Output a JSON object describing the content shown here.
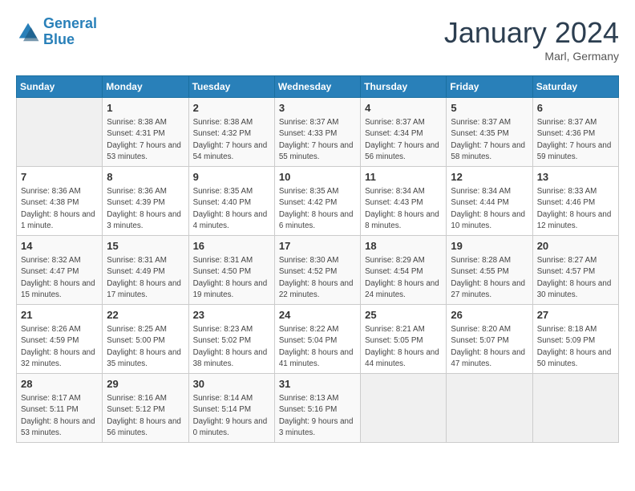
{
  "header": {
    "logo_line1": "General",
    "logo_line2": "Blue",
    "month": "January 2024",
    "location": "Marl, Germany"
  },
  "days_of_week": [
    "Sunday",
    "Monday",
    "Tuesday",
    "Wednesday",
    "Thursday",
    "Friday",
    "Saturday"
  ],
  "weeks": [
    [
      {
        "day": "",
        "sunrise": "",
        "sunset": "",
        "daylight": ""
      },
      {
        "day": "1",
        "sunrise": "Sunrise: 8:38 AM",
        "sunset": "Sunset: 4:31 PM",
        "daylight": "Daylight: 7 hours and 53 minutes."
      },
      {
        "day": "2",
        "sunrise": "Sunrise: 8:38 AM",
        "sunset": "Sunset: 4:32 PM",
        "daylight": "Daylight: 7 hours and 54 minutes."
      },
      {
        "day": "3",
        "sunrise": "Sunrise: 8:37 AM",
        "sunset": "Sunset: 4:33 PM",
        "daylight": "Daylight: 7 hours and 55 minutes."
      },
      {
        "day": "4",
        "sunrise": "Sunrise: 8:37 AM",
        "sunset": "Sunset: 4:34 PM",
        "daylight": "Daylight: 7 hours and 56 minutes."
      },
      {
        "day": "5",
        "sunrise": "Sunrise: 8:37 AM",
        "sunset": "Sunset: 4:35 PM",
        "daylight": "Daylight: 7 hours and 58 minutes."
      },
      {
        "day": "6",
        "sunrise": "Sunrise: 8:37 AM",
        "sunset": "Sunset: 4:36 PM",
        "daylight": "Daylight: 7 hours and 59 minutes."
      }
    ],
    [
      {
        "day": "7",
        "sunrise": "Sunrise: 8:36 AM",
        "sunset": "Sunset: 4:38 PM",
        "daylight": "Daylight: 8 hours and 1 minute."
      },
      {
        "day": "8",
        "sunrise": "Sunrise: 8:36 AM",
        "sunset": "Sunset: 4:39 PM",
        "daylight": "Daylight: 8 hours and 3 minutes."
      },
      {
        "day": "9",
        "sunrise": "Sunrise: 8:35 AM",
        "sunset": "Sunset: 4:40 PM",
        "daylight": "Daylight: 8 hours and 4 minutes."
      },
      {
        "day": "10",
        "sunrise": "Sunrise: 8:35 AM",
        "sunset": "Sunset: 4:42 PM",
        "daylight": "Daylight: 8 hours and 6 minutes."
      },
      {
        "day": "11",
        "sunrise": "Sunrise: 8:34 AM",
        "sunset": "Sunset: 4:43 PM",
        "daylight": "Daylight: 8 hours and 8 minutes."
      },
      {
        "day": "12",
        "sunrise": "Sunrise: 8:34 AM",
        "sunset": "Sunset: 4:44 PM",
        "daylight": "Daylight: 8 hours and 10 minutes."
      },
      {
        "day": "13",
        "sunrise": "Sunrise: 8:33 AM",
        "sunset": "Sunset: 4:46 PM",
        "daylight": "Daylight: 8 hours and 12 minutes."
      }
    ],
    [
      {
        "day": "14",
        "sunrise": "Sunrise: 8:32 AM",
        "sunset": "Sunset: 4:47 PM",
        "daylight": "Daylight: 8 hours and 15 minutes."
      },
      {
        "day": "15",
        "sunrise": "Sunrise: 8:31 AM",
        "sunset": "Sunset: 4:49 PM",
        "daylight": "Daylight: 8 hours and 17 minutes."
      },
      {
        "day": "16",
        "sunrise": "Sunrise: 8:31 AM",
        "sunset": "Sunset: 4:50 PM",
        "daylight": "Daylight: 8 hours and 19 minutes."
      },
      {
        "day": "17",
        "sunrise": "Sunrise: 8:30 AM",
        "sunset": "Sunset: 4:52 PM",
        "daylight": "Daylight: 8 hours and 22 minutes."
      },
      {
        "day": "18",
        "sunrise": "Sunrise: 8:29 AM",
        "sunset": "Sunset: 4:54 PM",
        "daylight": "Daylight: 8 hours and 24 minutes."
      },
      {
        "day": "19",
        "sunrise": "Sunrise: 8:28 AM",
        "sunset": "Sunset: 4:55 PM",
        "daylight": "Daylight: 8 hours and 27 minutes."
      },
      {
        "day": "20",
        "sunrise": "Sunrise: 8:27 AM",
        "sunset": "Sunset: 4:57 PM",
        "daylight": "Daylight: 8 hours and 30 minutes."
      }
    ],
    [
      {
        "day": "21",
        "sunrise": "Sunrise: 8:26 AM",
        "sunset": "Sunset: 4:59 PM",
        "daylight": "Daylight: 8 hours and 32 minutes."
      },
      {
        "day": "22",
        "sunrise": "Sunrise: 8:25 AM",
        "sunset": "Sunset: 5:00 PM",
        "daylight": "Daylight: 8 hours and 35 minutes."
      },
      {
        "day": "23",
        "sunrise": "Sunrise: 8:23 AM",
        "sunset": "Sunset: 5:02 PM",
        "daylight": "Daylight: 8 hours and 38 minutes."
      },
      {
        "day": "24",
        "sunrise": "Sunrise: 8:22 AM",
        "sunset": "Sunset: 5:04 PM",
        "daylight": "Daylight: 8 hours and 41 minutes."
      },
      {
        "day": "25",
        "sunrise": "Sunrise: 8:21 AM",
        "sunset": "Sunset: 5:05 PM",
        "daylight": "Daylight: 8 hours and 44 minutes."
      },
      {
        "day": "26",
        "sunrise": "Sunrise: 8:20 AM",
        "sunset": "Sunset: 5:07 PM",
        "daylight": "Daylight: 8 hours and 47 minutes."
      },
      {
        "day": "27",
        "sunrise": "Sunrise: 8:18 AM",
        "sunset": "Sunset: 5:09 PM",
        "daylight": "Daylight: 8 hours and 50 minutes."
      }
    ],
    [
      {
        "day": "28",
        "sunrise": "Sunrise: 8:17 AM",
        "sunset": "Sunset: 5:11 PM",
        "daylight": "Daylight: 8 hours and 53 minutes."
      },
      {
        "day": "29",
        "sunrise": "Sunrise: 8:16 AM",
        "sunset": "Sunset: 5:12 PM",
        "daylight": "Daylight: 8 hours and 56 minutes."
      },
      {
        "day": "30",
        "sunrise": "Sunrise: 8:14 AM",
        "sunset": "Sunset: 5:14 PM",
        "daylight": "Daylight: 9 hours and 0 minutes."
      },
      {
        "day": "31",
        "sunrise": "Sunrise: 8:13 AM",
        "sunset": "Sunset: 5:16 PM",
        "daylight": "Daylight: 9 hours and 3 minutes."
      },
      {
        "day": "",
        "sunrise": "",
        "sunset": "",
        "daylight": ""
      },
      {
        "day": "",
        "sunrise": "",
        "sunset": "",
        "daylight": ""
      },
      {
        "day": "",
        "sunrise": "",
        "sunset": "",
        "daylight": ""
      }
    ]
  ]
}
